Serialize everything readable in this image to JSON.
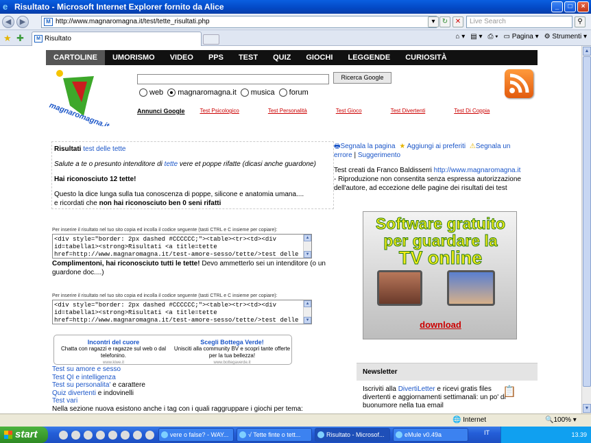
{
  "window": {
    "title": "Risultato - Microsoft Internet Explorer fornito da Alice"
  },
  "address": {
    "url": "http://www.magnaromagna.it/test/tette_risultati.php",
    "search_placeholder": "Live Search"
  },
  "tabs": [
    {
      "label": "Risultato"
    }
  ],
  "toolbar": {
    "page": "Pagina",
    "tools": "Strumenti"
  },
  "menu": [
    "CARTOLINE",
    "UMORISMO",
    "VIDEO",
    "PPS",
    "TEST",
    "QUIZ",
    "GIOCHI",
    "LEGGENDE",
    "CURIOSITÀ"
  ],
  "logo": {
    "text": "magnaromagna.it"
  },
  "search": {
    "button": "Ricerca Google",
    "options": [
      "web",
      "magnaromagna.it",
      "musica",
      "forum"
    ],
    "selected": "magnaromagna.it"
  },
  "ads": {
    "label": "Annunci Google",
    "links": [
      "Test Psicologico",
      "Test Personalità",
      "Test Gioco",
      "Test Divertenti",
      "Test Di Coppia"
    ]
  },
  "result": {
    "title_prefix": "Risultati",
    "title_link": "test delle tette",
    "intro_a": "Salute a te o presunto intenditore di ",
    "intro_link": "tette",
    "intro_b": " vere et poppe rifatte (dicasi anche guardone)",
    "count": "Hai riconosciuto 12 tette!",
    "line1": "Questo la dice lunga sulla tua conoscenza di poppe, silicone e anatomia umana....",
    "line2a": "e ricordati che ",
    "line2b": "non hai riconosciuto ben 0 seni rifatti"
  },
  "side": {
    "report": "Segnala la pagina",
    "favorites": "Aggiungi ai preferiti",
    "error": "Segnala un errore",
    "suggest": "Suggerimento",
    "credits_a": "Test creati da Franco Baldisserri ",
    "credits_link": "http://www.magnaromagna.it",
    "credits_b": " - Riproduzione non consentita senza espressa autorizzazione dell'autore, ad eccezione delle pagine dei risultati dei test"
  },
  "embed": {
    "hint": "Per inserire il risultato nel tuo sito copia ed incolla il codice seguente (tasti CTRL e C insieme per copiare):",
    "code": "<div style=\"border: 2px dashed #CCCCCC;\"><table><tr><td><div\nid=tabella1><strong>Risultati <a title=tette\nhref=http://www.magnaromagna.it/test-amore-sesso/tette/>test delle"
  },
  "compliment": {
    "bold": "Complimentoni, hai riconosciuto tutti le tette!",
    "rest": " Devo ammetterlo sei un intenditore (o un guardone doc....)"
  },
  "adbox": [
    {
      "title": "Incontri del cuore",
      "text": "Chatta con ragazzi e ragazze sul web o dal telefonino.",
      "url": "www.kiwe.it"
    },
    {
      "title": "Scegli Bottega Verde!",
      "text": "Unisciti alla community BV e scopri tante offerte per la tua bellezza!",
      "url": "www.bottegaverde.it"
    }
  ],
  "links": {
    "l1": "Test su amore e sesso",
    "l2": "Test QI e intelligenza",
    "l3": "Test su personalita'",
    "l3b": " e carattere",
    "l4": "Quiz divertenti",
    "l4b": " e indovinelli",
    "l5": "Test vari",
    "l6": "Nella sezione nuova esistono anche i tag con i quali raggruppare i giochi per tema:"
  },
  "tvad": {
    "line1": "Software gratuito",
    "line2": "per guardare la",
    "line3": "TV online",
    "download": "download"
  },
  "newsletter": {
    "title": "Newsletter",
    "text_a": "Iscriviti alla ",
    "text_link": "DivertiLetter",
    "text_b": " e ricevi gratis files divertenti e aggiornamenti settimanali: un po' di buonumore nella tua email"
  },
  "status": {
    "zone": "Internet",
    "zoom": "100%"
  },
  "taskbar": {
    "start": "start",
    "tasks": [
      "vere o false? - WAY...",
      "√ Tette finte o tett...",
      "Risultato - Microsof...",
      "eMule v0.49a"
    ],
    "lang": "IT",
    "clock": "13.39"
  },
  "colors": {
    "link": "#1a55c8",
    "ad_link": "#cc0000",
    "menu_bg": "#111111"
  }
}
